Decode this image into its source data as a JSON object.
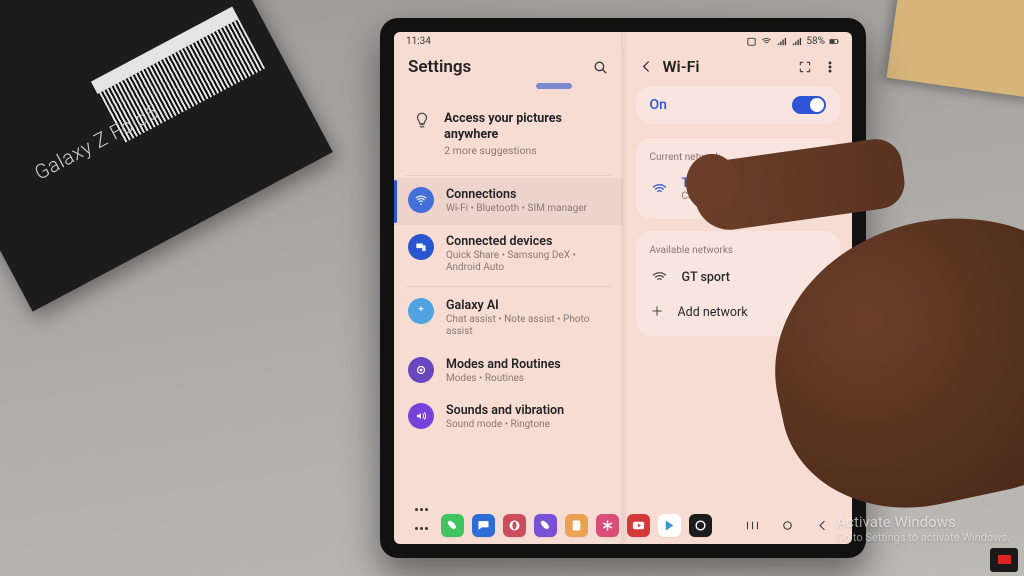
{
  "env": {
    "box_label": "Galaxy Z Fold6",
    "watermark_line1": "Activate Windows",
    "watermark_line2": "Go to Settings to activate Windows."
  },
  "status": {
    "time": "11:34",
    "battery_text": "58%"
  },
  "left": {
    "title": "Settings",
    "suggestion": {
      "title": "Access your pictures anywhere",
      "subtitle": "2 more suggestions"
    },
    "items": [
      {
        "title": "Connections",
        "sub": "Wi-Fi • Bluetooth • SIM manager",
        "color": "c-blue",
        "icon": "wifi",
        "selected": true
      },
      {
        "title": "Connected devices",
        "sub": "Quick Share • Samsung DeX • Android Auto",
        "color": "c-blue2",
        "icon": "devices"
      },
      {
        "title": "Galaxy AI",
        "sub": "Chat assist • Note assist • Photo assist",
        "color": "c-ltblue",
        "icon": "sparkle"
      },
      {
        "title": "Modes and Routines",
        "sub": "Modes • Routines",
        "color": "c-purple",
        "icon": "routines"
      },
      {
        "title": "Sounds and vibration",
        "sub": "Sound mode • Ringtone",
        "color": "c-violet",
        "icon": "sound"
      }
    ]
  },
  "right": {
    "title": "Wi-Fi",
    "on_label": "On",
    "on_state": true,
    "current_label": "Current network",
    "current": {
      "ssid": "Tenda_B73FF0",
      "status": "Connected"
    },
    "available_label": "Available networks",
    "available": [
      {
        "ssid": "GT sport"
      }
    ],
    "add_label": "Add network"
  },
  "dock": {
    "apps": [
      {
        "name": "phone",
        "bg": "#37c75a"
      },
      {
        "name": "messages",
        "bg": "#2a6ee0"
      },
      {
        "name": "opera",
        "bg": "#d64a5a"
      },
      {
        "name": "viber",
        "bg": "#7a4fe0"
      },
      {
        "name": "notes",
        "bg": "#f0a14a"
      },
      {
        "name": "asterisk",
        "bg": "#e24a7a"
      },
      {
        "name": "youtube",
        "bg": "#e03535"
      },
      {
        "name": "play",
        "bg": "#fefefe"
      },
      {
        "name": "circle",
        "bg": "#1c1c1c"
      }
    ]
  }
}
